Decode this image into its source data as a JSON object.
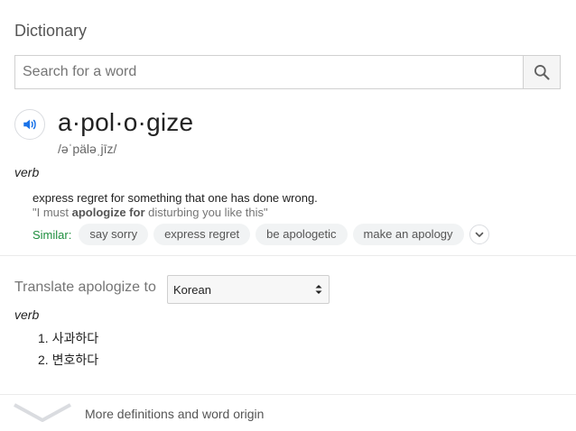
{
  "card": {
    "title": "Dictionary"
  },
  "search": {
    "placeholder": "Search for a word",
    "value": "",
    "icon": "search-icon"
  },
  "entry": {
    "speaker_icon": "speaker-icon",
    "headword": "a·pol·o·gize",
    "phonetic": "/əˈpäləˌjīz/",
    "part_of_speech": "verb",
    "definition": "express regret for something that one has done wrong.",
    "example": {
      "open_quote": "\"I must ",
      "bold": "apologize for",
      "rest": " disturbing you like this\""
    },
    "similar_label": "Similar:",
    "similar": [
      "say sorry",
      "express regret",
      "be apologetic",
      "make an apology"
    ],
    "expand_icon": "chevron-down-icon"
  },
  "translate": {
    "label": "Translate apologize to",
    "language": "Korean",
    "part_of_speech": "verb",
    "items": [
      "1. 사과하다",
      "2. 변호하다"
    ]
  },
  "footer": {
    "text": "More definitions and word origin",
    "icon": "chevron-down-icon"
  },
  "colors": {
    "accent_blue": "#1a73e8",
    "similar_green": "#1e8e3e",
    "chip_bg": "#f1f3f4"
  }
}
